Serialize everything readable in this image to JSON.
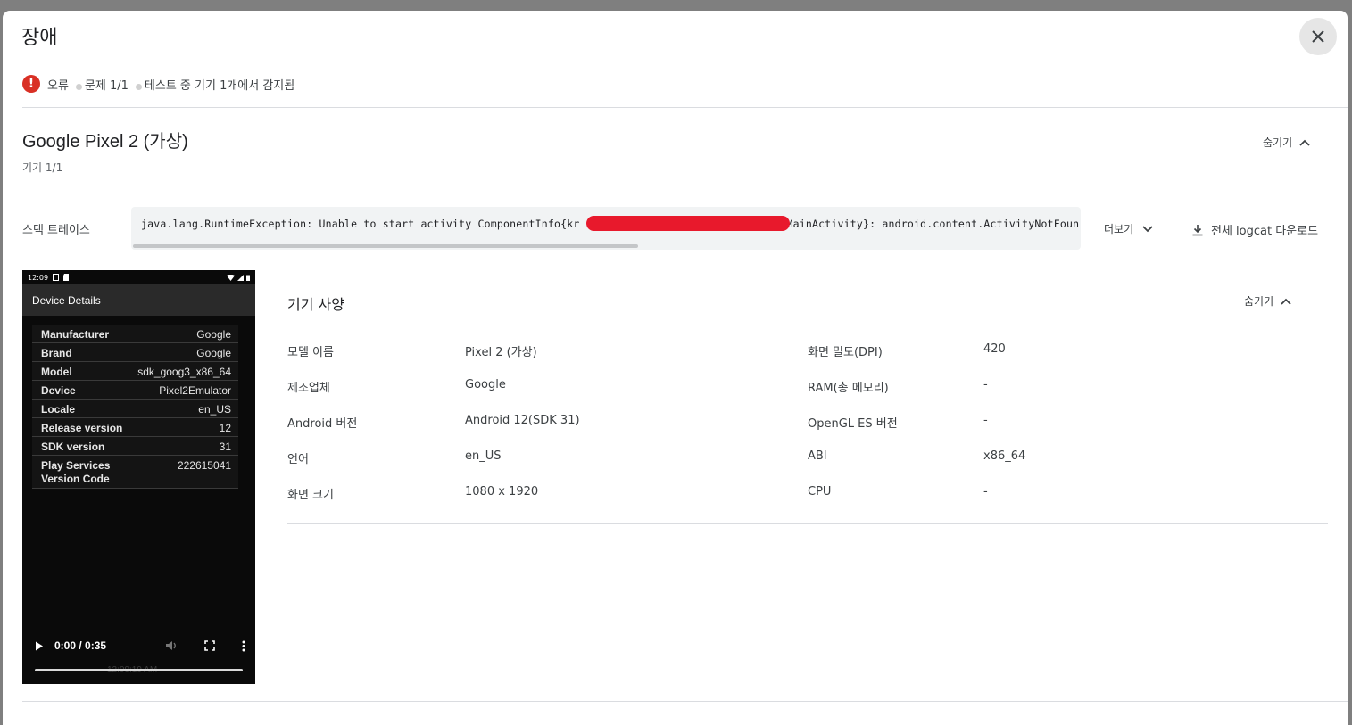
{
  "dialog": {
    "title": "장애",
    "summary": {
      "severity": "오류",
      "issues": "문제 1/1",
      "detected": "테스트 중 기기 1개에서 감지됨"
    },
    "colors": {
      "error": "#d93025",
      "redaction": "#e8192c"
    }
  },
  "device": {
    "name": "Google Pixel 2 (가상)",
    "count": "기기 1/1",
    "hide_label": "숨기기"
  },
  "stack_trace": {
    "label": "스택 트레이스",
    "text_before": "java.lang.RuntimeException: Unable to start activity ComponentInfo{kr",
    "text_after": "MainActivity}: android.content.ActivityNotFoun",
    "more_label": "더보기",
    "download_label": "전체 logcat 다운로드"
  },
  "phone": {
    "status_time": "12:09",
    "app_title": "Device Details",
    "rows": [
      {
        "key": "Manufacturer",
        "value": "Google"
      },
      {
        "key": "Brand",
        "value": "Google"
      },
      {
        "key": "Model",
        "value": "sdk_goog3_x86_64"
      },
      {
        "key": "Device",
        "value": "Pixel2Emulator"
      },
      {
        "key": "Locale",
        "value": "en_US"
      },
      {
        "key": "Release version",
        "value": "12"
      },
      {
        "key": "SDK version",
        "value": "31"
      },
      {
        "key": "Play Services Version Code",
        "value": "222615041"
      }
    ],
    "video": {
      "time": "0:00 / 0:35",
      "ghost_time": "12:09:19 AM",
      "progress": 0
    }
  },
  "specs": {
    "title": "기기 사양",
    "hide_label": "숨기기",
    "rows": [
      {
        "label1": "모델 이름",
        "value1": "Pixel 2 (가상)",
        "label2": "화면 밀도(DPI)",
        "value2": "420"
      },
      {
        "label1": "제조업체",
        "value1": "Google",
        "label2": "RAM(총 메모리)",
        "value2": "-"
      },
      {
        "label1": "Android 버전",
        "value1": "Android 12(SDK 31)",
        "label2": "OpenGL ES 버전",
        "value2": "-"
      },
      {
        "label1": "언어",
        "value1": "en_US",
        "label2": "ABI",
        "value2": "x86_64"
      },
      {
        "label1": "화면 크기",
        "value1": "1080 x 1920",
        "label2": "CPU",
        "value2": "-"
      }
    ]
  }
}
